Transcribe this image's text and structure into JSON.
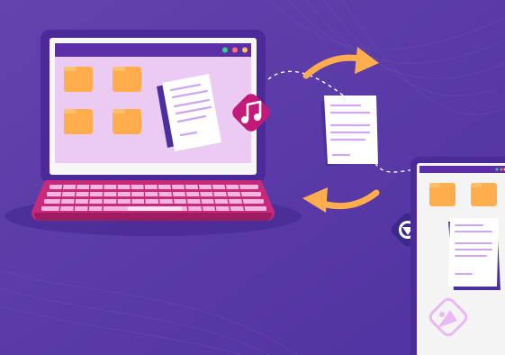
{
  "illustration": {
    "theme": "file-transfer-between-computers",
    "colors": {
      "background": "#5a3aa4",
      "background_light": "#6a4bb4",
      "laptop_frame": "#4b2a9a",
      "laptop_titlebar": "#5b2fa8",
      "screen_bg": "#ebcbf3",
      "folder": "#ffad4d",
      "folder_tab": "#ffc06a",
      "document": "#ffffff",
      "document_line": "#cfa6ef",
      "document_shadow": "#4a2f9f",
      "keyboard_base": "#c8297a",
      "keyboard_keys": "#f3b6e0",
      "arrow": "#ffad4d",
      "badge_music": "#c2197a",
      "badge_video": "#3b2a8a",
      "tablet_bg": "#f4f4f4",
      "dot_green": "#2fd38a",
      "dot_red": "#ff6f6f",
      "dot_yellow": "#ffc34d"
    },
    "icons": [
      "music-note-icon",
      "play-down-icon",
      "image-icon",
      "folder-icon",
      "document-icon",
      "arrow-icon"
    ]
  }
}
